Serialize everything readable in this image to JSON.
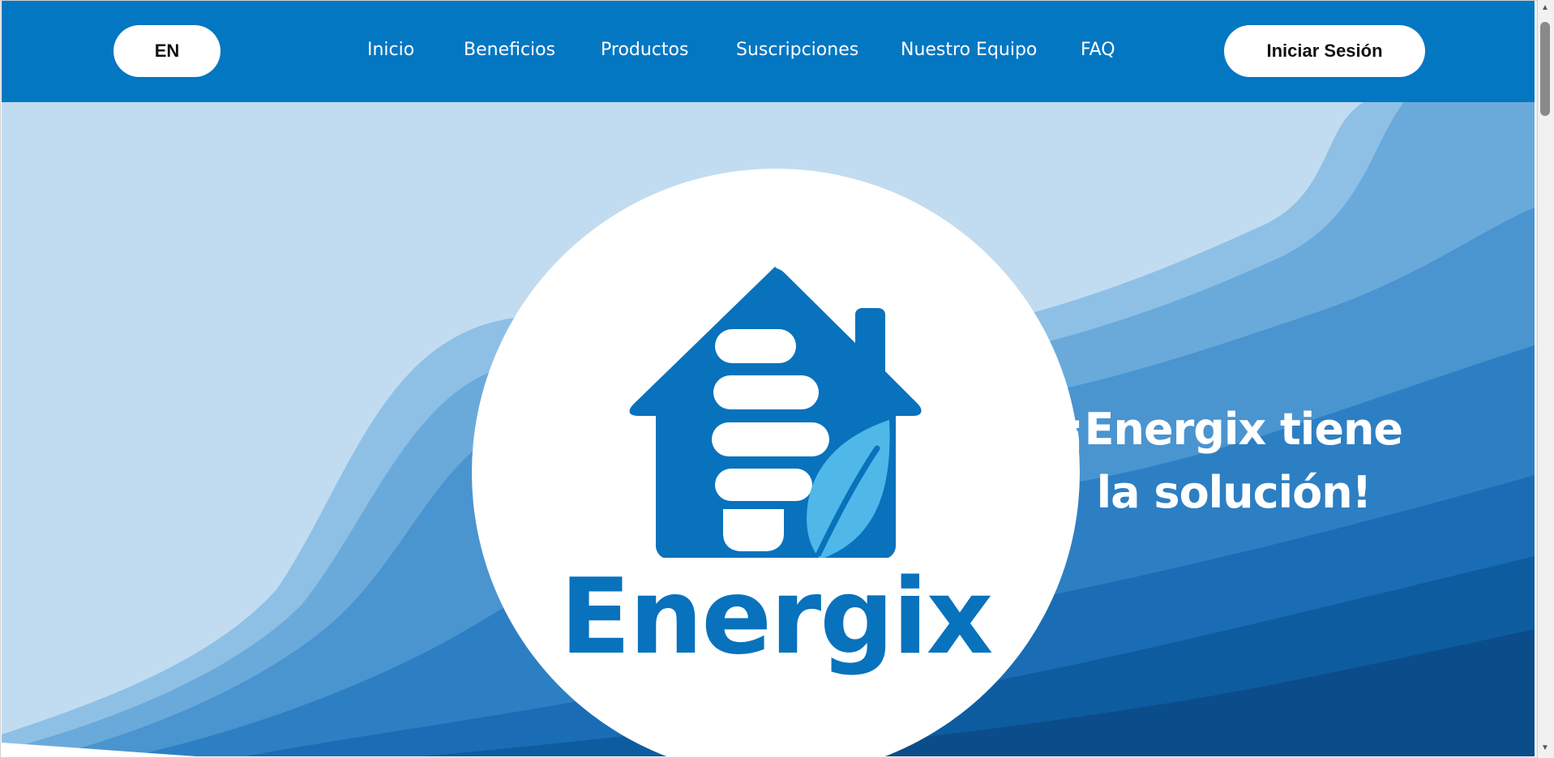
{
  "navbar": {
    "language_label": "EN",
    "links": [
      "Inicio",
      "Beneficios",
      "Productos",
      "Suscripciones",
      "Nuestro Equipo",
      "FAQ"
    ],
    "login_label": "Iniciar Sesión",
    "background_color": "#0477c2"
  },
  "hero": {
    "brand_name": "Energix",
    "tagline_line1": "¡Energix tiene",
    "tagline_line2": "la solución!",
    "logo_icon": "house-lightbulb-leaf-icon"
  },
  "colors": {
    "brand_blue": "#0872bd",
    "leaf_blue": "#4fb8e8",
    "sky": "#c1dcf1"
  },
  "scrollbar": {
    "up_icon": "scroll-up-arrow-icon",
    "down_icon": "scroll-down-arrow-icon"
  }
}
